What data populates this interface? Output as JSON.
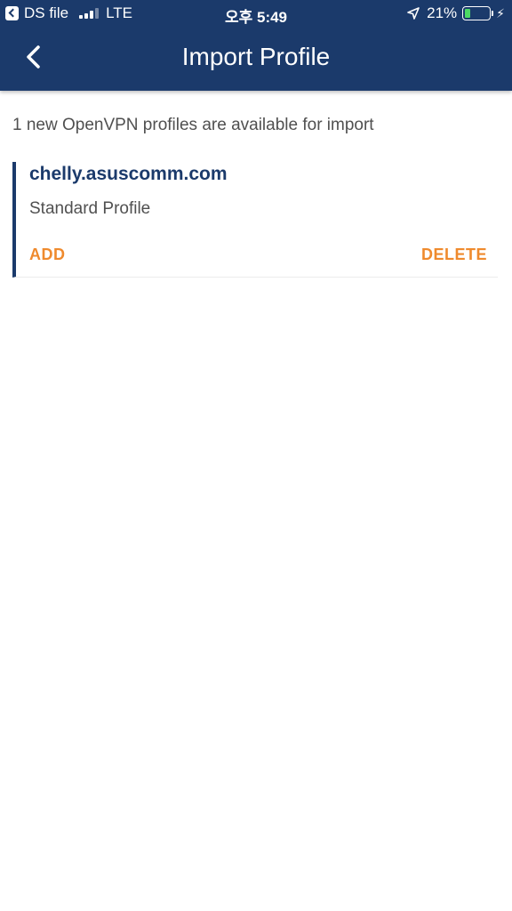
{
  "status_bar": {
    "back_app": "DS file",
    "network": "LTE",
    "time": "오후 5:49",
    "battery": "21%",
    "battery_level": 0.21,
    "battery_color": "#4cd964"
  },
  "header": {
    "title": "Import Profile",
    "back_icon": "chevron-left-icon",
    "background": "#1b3a6b"
  },
  "content": {
    "info": "1 new OpenVPN profiles are available for import",
    "profiles": [
      {
        "name": "chelly.asuscomm.com",
        "type": "Standard Profile",
        "add_label": "ADD",
        "delete_label": "DELETE"
      }
    ],
    "accent_color": "#ef8a2d"
  }
}
